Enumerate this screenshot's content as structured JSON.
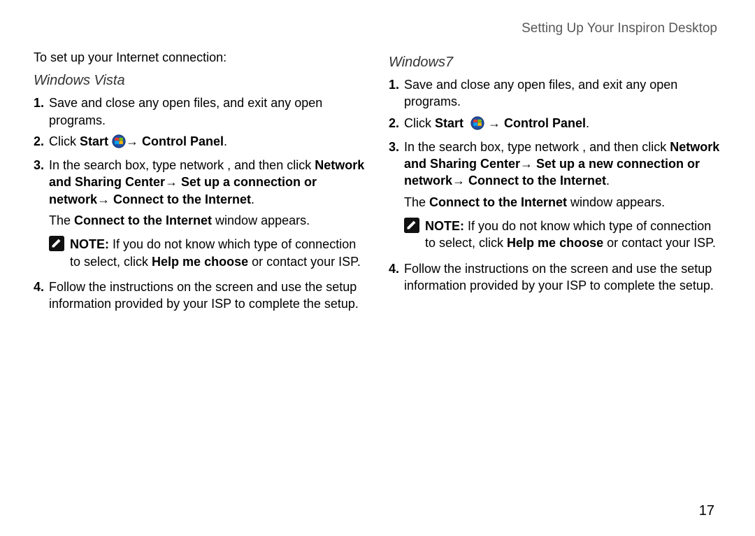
{
  "header": "Setting Up Your Inspiron Desktop",
  "intro": "To set up your Internet connection:",
  "page_number": "17",
  "vista": {
    "heading": "Windows Vista",
    "steps": [
      {
        "num": "1.",
        "p1": "Save and close any open files, and exit any open programs."
      },
      {
        "num": "2.",
        "click": "Click ",
        "start": "Start ",
        "arrow_cp": "→ Control Panel",
        "period": "."
      },
      {
        "num": "3.",
        "lead": "In the search box, type network  , and then click ",
        "bold1": "Network and Sharing Center→ Set up a connection or network→ Connect to the Internet",
        "after": ".",
        "appears_a": "The ",
        "appears_b": "Connect to the Internet",
        "appears_c": " window appears."
      },
      {
        "num": "4.",
        "p1": "Follow the instructions on the screen and use the setup information provided by your ISP to complete the setup."
      }
    ],
    "note": {
      "note_label": "NOTE:",
      "a": " If you do not know which type of connection to select, click ",
      "b": "Help me choose",
      "c": " or contact your ISP."
    }
  },
  "win7": {
    "heading": "Windows7",
    "steps": [
      {
        "num": "1.",
        "p1": "Save and close any open files, and exit any open programs."
      },
      {
        "num": "2.",
        "click": "Click ",
        "start": "Start ",
        "arrow_cp": " → Control Panel",
        "period": "."
      },
      {
        "num": "3.",
        "lead": "In the search box, type network  , and then click ",
        "bold1": "Network and Sharing Center→ Set up a new connection or network→ Connect to the Internet",
        "after": ".",
        "appears_a": "The ",
        "appears_b": "Connect to the Internet",
        "appears_c": " window appears."
      },
      {
        "num": "4.",
        "p1": "Follow the instructions on the screen and use the setup information provided by your ISP to complete the setup."
      }
    ],
    "note": {
      "note_label": "NOTE:",
      "a": " If you do not know which type of connection to select, click ",
      "b": "Help me choose",
      "c": " or contact your ISP."
    }
  }
}
